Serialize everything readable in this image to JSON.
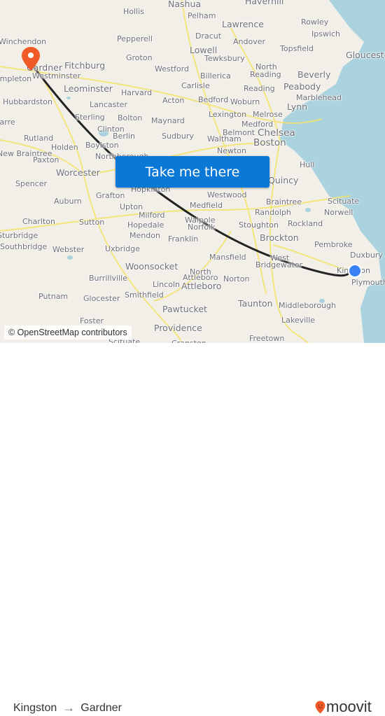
{
  "map": {
    "cta_label": "Take me there",
    "attribution": "© OpenStreetMap contributors",
    "origin_marker": {
      "place": "Kingston",
      "color": "#3b82f6"
    },
    "destination_marker": {
      "place": "Gardner",
      "color": "#f05a28"
    },
    "route_color": "#222222",
    "water_color": "#aad3df",
    "land_color": "#f2efe9",
    "road_color": "#f7e85a",
    "labels": [
      {
        "text": "Nashua",
        "size": "s2"
      },
      {
        "text": "Haverhill",
        "size": "s2"
      },
      {
        "text": "Hollis",
        "size": "s1"
      },
      {
        "text": "Pelham",
        "size": "s1"
      },
      {
        "text": "Lawrence",
        "size": "s2"
      },
      {
        "text": "Rowley",
        "size": "s1"
      },
      {
        "text": "Ipswich",
        "size": "s1"
      },
      {
        "text": "Winchendon",
        "size": "s1"
      },
      {
        "text": "Pepperell",
        "size": "s1"
      },
      {
        "text": "Dracut",
        "size": "s1"
      },
      {
        "text": "Andover",
        "size": "s1"
      },
      {
        "text": "Gardner",
        "size": "s2"
      },
      {
        "text": "Fitchburg",
        "size": "s2"
      },
      {
        "text": "Groton",
        "size": "s1"
      },
      {
        "text": "Lowell",
        "size": "s2"
      },
      {
        "text": "Tewksbury",
        "size": "s1"
      },
      {
        "text": "Topsfield",
        "size": "s1"
      },
      {
        "text": "Gloucester",
        "size": "s2"
      },
      {
        "text": "Westminster",
        "size": "s1"
      },
      {
        "text": "Westford",
        "size": "s1"
      },
      {
        "text": "North",
        "size": "s1"
      },
      {
        "text": "Reading",
        "size": "s1"
      },
      {
        "text": "Beverly",
        "size": "s2"
      },
      {
        "text": "Templeton",
        "size": "s1"
      },
      {
        "text": "Leominster",
        "size": "s2"
      },
      {
        "text": "Billerica",
        "size": "s1"
      },
      {
        "text": "Carlisle",
        "size": "s1"
      },
      {
        "text": "Reading",
        "size": "s1"
      },
      {
        "text": "Peabody",
        "size": "s2"
      },
      {
        "text": "Harvard",
        "size": "s1"
      },
      {
        "text": "Marblehead",
        "size": "s1"
      },
      {
        "text": "Hubbardston",
        "size": "s1"
      },
      {
        "text": "Lancaster",
        "size": "s1"
      },
      {
        "text": "Acton",
        "size": "s1"
      },
      {
        "text": "Bedford",
        "size": "s1"
      },
      {
        "text": "Woburn",
        "size": "s1"
      },
      {
        "text": "Melrose",
        "size": "s1"
      },
      {
        "text": "Lynn",
        "size": "s2"
      },
      {
        "text": "Lexington",
        "size": "s1"
      },
      {
        "text": "Barre",
        "size": "s1"
      },
      {
        "text": "Sterling",
        "size": "s1"
      },
      {
        "text": "Bolton",
        "size": "s1"
      },
      {
        "text": "Maynard",
        "size": "s1"
      },
      {
        "text": "Medford",
        "size": "s1"
      },
      {
        "text": "Clinton",
        "size": "s1"
      },
      {
        "text": "Belmont",
        "size": "s1"
      },
      {
        "text": "Chelsea",
        "size": "s3"
      },
      {
        "text": "Rutland",
        "size": "s1"
      },
      {
        "text": "Berlin",
        "size": "s1"
      },
      {
        "text": "Sudbury",
        "size": "s1"
      },
      {
        "text": "Waltham",
        "size": "s1"
      },
      {
        "text": "Holden",
        "size": "s1"
      },
      {
        "text": "Boylston",
        "size": "s1"
      },
      {
        "text": "Boston",
        "size": "s3"
      },
      {
        "text": "New Braintree",
        "size": "s1"
      },
      {
        "text": "Newton",
        "size": "s1"
      },
      {
        "text": "Northborough",
        "size": "s1"
      },
      {
        "text": "Paxton",
        "size": "s1"
      },
      {
        "text": "Hull",
        "size": "s1"
      },
      {
        "text": "Worcester",
        "size": "s2"
      },
      {
        "text": "Spencer",
        "size": "s1"
      },
      {
        "text": "Quincy",
        "size": "s2"
      },
      {
        "text": "Hopkinton",
        "size": "s1"
      },
      {
        "text": "Grafton",
        "size": "s1"
      },
      {
        "text": "Westwood",
        "size": "s1"
      },
      {
        "text": "Braintree",
        "size": "s1"
      },
      {
        "text": "Auburn",
        "size": "s1"
      },
      {
        "text": "Scituate",
        "size": "s1"
      },
      {
        "text": "Medfield",
        "size": "s1"
      },
      {
        "text": "Upton",
        "size": "s1"
      },
      {
        "text": "Norwell",
        "size": "s1"
      },
      {
        "text": "Randolph",
        "size": "s1"
      },
      {
        "text": "Charlton",
        "size": "s1"
      },
      {
        "text": "Sutton",
        "size": "s1"
      },
      {
        "text": "Milford",
        "size": "s1"
      },
      {
        "text": "Walpole",
        "size": "s1"
      },
      {
        "text": "Stoughton",
        "size": "s1"
      },
      {
        "text": "Rockland",
        "size": "s1"
      },
      {
        "text": "Norfolk",
        "size": "s1"
      },
      {
        "text": "Hopedale",
        "size": "s1"
      },
      {
        "text": "Sturbridge",
        "size": "s1"
      },
      {
        "text": "Mendon",
        "size": "s1"
      },
      {
        "text": "Franklin",
        "size": "s1"
      },
      {
        "text": "Brockton",
        "size": "s2"
      },
      {
        "text": "Southbridge",
        "size": "s1"
      },
      {
        "text": "Pembroke",
        "size": "s1"
      },
      {
        "text": "Webster",
        "size": "s1"
      },
      {
        "text": "Uxbridge",
        "size": "s1"
      },
      {
        "text": "Duxbury",
        "size": "s1"
      },
      {
        "text": "Mansfield",
        "size": "s1"
      },
      {
        "text": "West",
        "size": "s1"
      },
      {
        "text": "Bridgewater",
        "size": "s1"
      },
      {
        "text": "Woonsocket",
        "size": "s2"
      },
      {
        "text": "Kingston",
        "size": "s1"
      },
      {
        "text": "North",
        "size": "s1"
      },
      {
        "text": "Attleboro",
        "size": "s1"
      },
      {
        "text": "Plymouth",
        "size": "s1"
      },
      {
        "text": "Burrillville",
        "size": "s1"
      },
      {
        "text": "Norton",
        "size": "s1"
      },
      {
        "text": "Lincoln",
        "size": "s1"
      },
      {
        "text": "Attleboro",
        "size": "s2"
      },
      {
        "text": "Putnam",
        "size": "s1"
      },
      {
        "text": "Glocester",
        "size": "s1"
      },
      {
        "text": "Smithfield",
        "size": "s1"
      },
      {
        "text": "Taunton",
        "size": "s2"
      },
      {
        "text": "Middleborough",
        "size": "s1"
      },
      {
        "text": "Pawtucket",
        "size": "s2"
      },
      {
        "text": "Foster",
        "size": "s1"
      },
      {
        "text": "Lakeville",
        "size": "s1"
      },
      {
        "text": "Providence",
        "size": "s2"
      },
      {
        "text": "Freetown",
        "size": "s1"
      },
      {
        "text": "Scituate",
        "size": "s1"
      },
      {
        "text": "Cranston",
        "size": "s1"
      }
    ]
  },
  "footer": {
    "origin": "Kingston",
    "arrow": "→",
    "destination": "Gardner",
    "brand": "moovit",
    "brand_color": "#f05a28"
  }
}
